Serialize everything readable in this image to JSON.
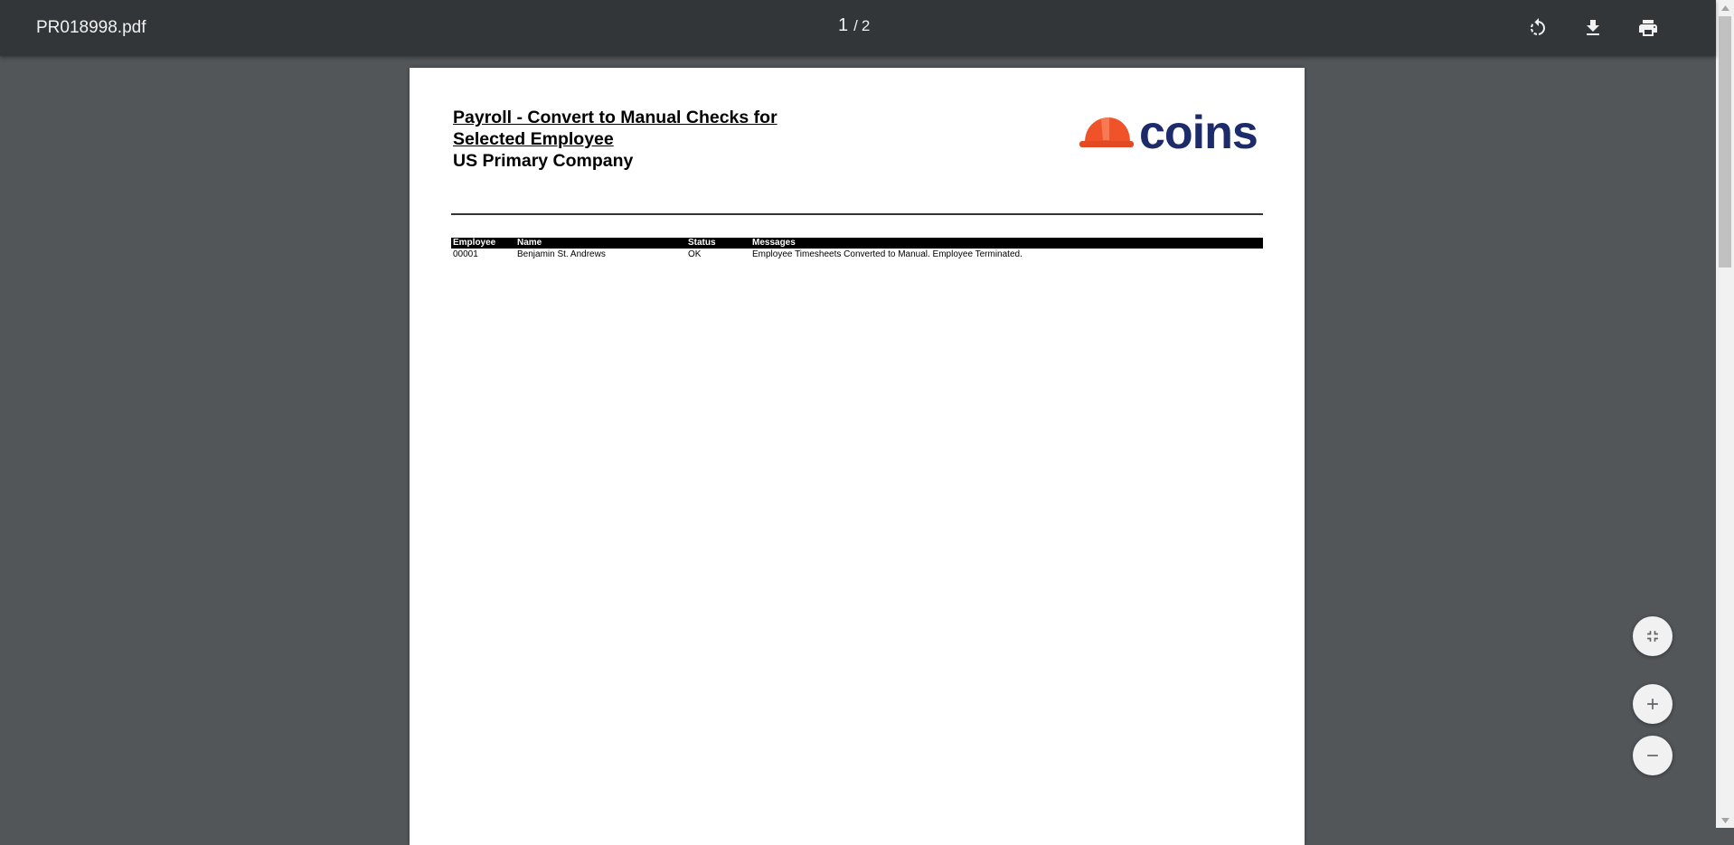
{
  "viewer": {
    "file_name": "PR018998.pdf",
    "current_page": "1",
    "page_separator": "/",
    "total_pages": "2",
    "rotate_icon": "rotate-icon",
    "download_icon": "download-icon",
    "print_icon": "print-icon"
  },
  "document": {
    "title_line1": "Payroll - Convert to Manual Checks for",
    "title_line2": "Selected Employee",
    "company": "US Primary Company",
    "logo_text": "coins",
    "table": {
      "headers": [
        "Employee",
        "Name",
        "Status",
        "Messages"
      ],
      "rows": [
        [
          "00001",
          "Benjamin St. Andrews",
          "OK",
          "Employee Timesheets Converted to Manual. Employee Terminated."
        ]
      ]
    }
  },
  "controls": {
    "fit_icon": "fit-to-page-icon",
    "zoom_in_icon": "plus-icon",
    "zoom_out_icon": "minus-icon"
  },
  "colors": {
    "toolbar_bg": "#323639",
    "viewer_bg": "#525659",
    "logo_helmet": "#f0532a",
    "logo_text": "#1d2b6b"
  }
}
